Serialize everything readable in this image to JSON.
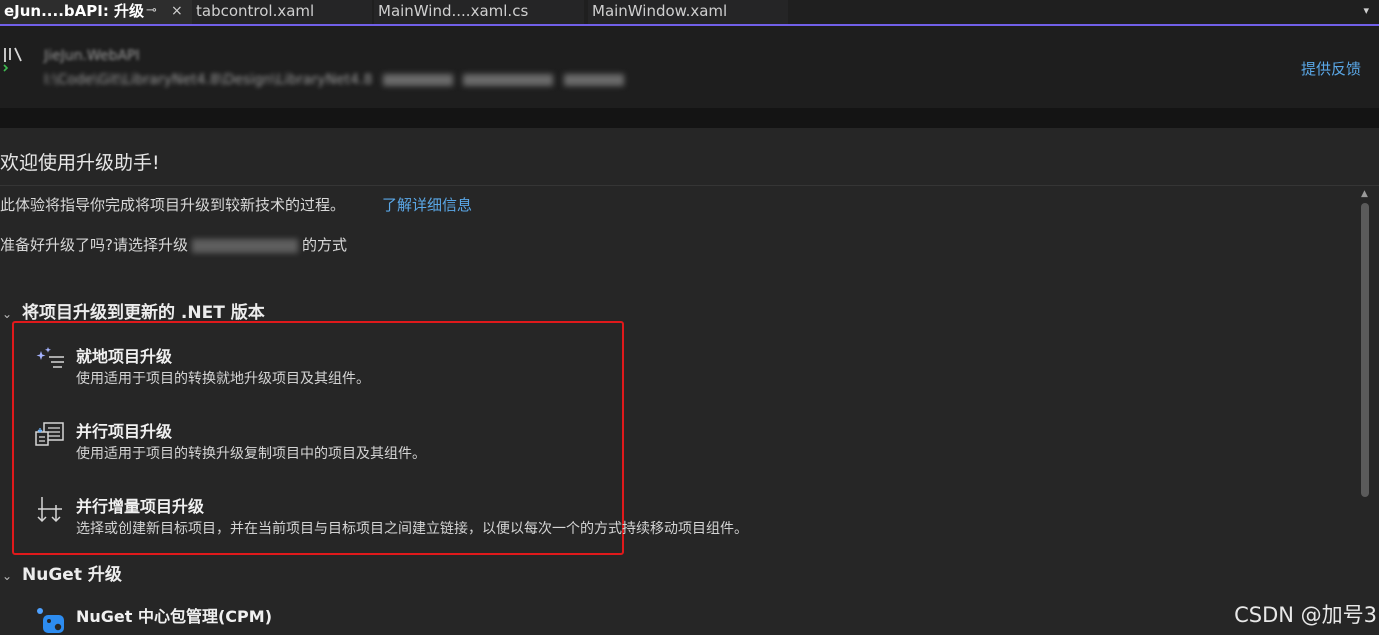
{
  "tabs": {
    "active_label": "eJun....bAPI: 升级",
    "pin_glyph": "⊸",
    "close_glyph": "×",
    "items": [
      "tabcontrol.xaml",
      "MainWind....xaml.cs",
      "MainWindow.xaml"
    ],
    "overflow_glyph": "▾"
  },
  "header": {
    "project_name": "JieJun.WebAPI",
    "project_path": "I:\\Code\\Git\\LibraryNet4.8\\Design\\LibraryNet4.8",
    "feedback_label": "提供反馈"
  },
  "main": {
    "welcome": "欢迎使用升级助手!",
    "intro_text": "此体验将指导你完成将项目升级到较新技术的过程。",
    "learn_more": "了解详细信息",
    "prompt_prefix": "准备好升级了吗?请选择升级",
    "prompt_suffix": "的方式",
    "section_dotnet": {
      "title": "将项目升级到更新的 .NET 版本",
      "options": [
        {
          "title": "就地项目升级",
          "desc": "使用适用于项目的转换就地升级项目及其组件。",
          "icon": "sparkle-list-icon"
        },
        {
          "title": "并行项目升级",
          "desc": "使用适用于项目的转换升级复制项目中的项目及其组件。",
          "icon": "side-by-side-icon"
        },
        {
          "title": "并行增量项目升级",
          "desc": "选择或创建新目标项目，并在当前项目与目标项目之间建立链接，以便以每次一个的方式持续移动项目组件。",
          "icon": "branch-arrows-icon"
        }
      ]
    },
    "section_nuget": {
      "title": "NuGet 升级",
      "options": [
        {
          "title": "NuGet 中心包管理(CPM)",
          "icon": "nuget-icon"
        }
      ]
    }
  },
  "watermark": "CSDN @加号3",
  "colors": {
    "accent": "#7160e8",
    "link": "#5aa7e6",
    "highlight_border": "#e0191b",
    "background": "#262626"
  }
}
